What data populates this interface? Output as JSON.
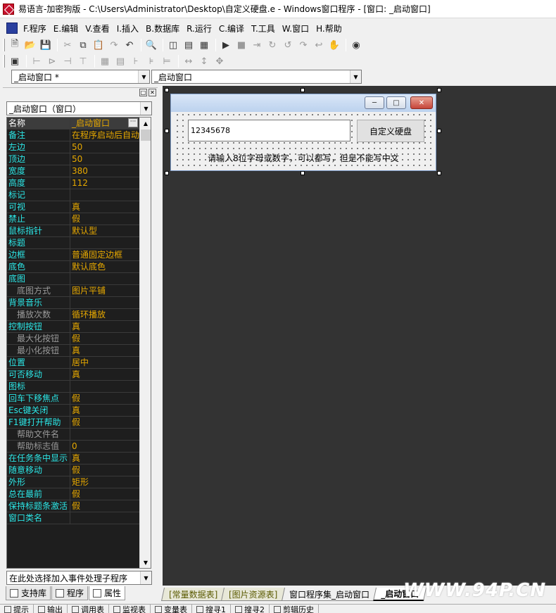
{
  "window": {
    "title": "易语言-加密狗版 - C:\\Users\\Administrator\\Desktop\\自定义硬盘.e - Windows窗口程序 - [窗口: _启动窗口]"
  },
  "menu": [
    {
      "label": "F.程序"
    },
    {
      "label": "E.编辑"
    },
    {
      "label": "V.查看"
    },
    {
      "label": "I.插入"
    },
    {
      "label": "B.数据库"
    },
    {
      "label": "R.运行"
    },
    {
      "label": "C.编译"
    },
    {
      "label": "T.工具"
    },
    {
      "label": "W.窗口"
    },
    {
      "label": "H.帮助"
    }
  ],
  "toolbar": {
    "icons": [
      "new-file-icon",
      "open-folder-icon",
      "save-icon",
      "cut-icon",
      "copy-icon",
      "paste-icon",
      "redo-icon",
      "undo-icon",
      "find-icon",
      "layout1-icon",
      "layout2-icon",
      "layout3-icon",
      "run-icon",
      "stop-icon",
      "step1-icon",
      "step2-icon",
      "step3-icon",
      "step4-icon",
      "step5-icon",
      "hand-icon",
      "binoculars-icon"
    ]
  },
  "selectors": {
    "left": "_启动窗口 *",
    "right": "_启动窗口"
  },
  "properties": {
    "object_combo": "_启动窗口（窗口）",
    "event_combo": "在此处选择加入事件处理子程序",
    "rows": [
      {
        "name": "名称",
        "value": "_启动窗口",
        "selected": true
      },
      {
        "name": "备注",
        "value": "在程序启动后自动"
      },
      {
        "name": "左边",
        "value": "50"
      },
      {
        "name": "顶边",
        "value": "50"
      },
      {
        "name": "宽度",
        "value": "380"
      },
      {
        "name": "高度",
        "value": "112"
      },
      {
        "name": "标记",
        "value": ""
      },
      {
        "name": "可视",
        "value": "真"
      },
      {
        "name": "禁止",
        "value": "假"
      },
      {
        "name": "鼠标指针",
        "value": "默认型"
      },
      {
        "name": "标题",
        "value": ""
      },
      {
        "name": "边框",
        "value": "普通固定边框"
      },
      {
        "name": "底色",
        "value": "默认底色"
      },
      {
        "name": "底图",
        "value": ""
      },
      {
        "name": "底图方式",
        "value": "图片平铺",
        "indent": true
      },
      {
        "name": "背景音乐",
        "value": ""
      },
      {
        "name": "播放次数",
        "value": "循环播放",
        "indent": true
      },
      {
        "name": "控制按钮",
        "value": "真"
      },
      {
        "name": "最大化按钮",
        "value": "假",
        "indent": true
      },
      {
        "name": "最小化按钮",
        "value": "真",
        "indent": true
      },
      {
        "name": "位置",
        "value": "居中"
      },
      {
        "name": "可否移动",
        "value": "真"
      },
      {
        "name": "图标",
        "value": ""
      },
      {
        "name": "回车下移焦点",
        "value": "假"
      },
      {
        "name": "Esc键关闭",
        "value": "真"
      },
      {
        "name": "F1键打开帮助",
        "value": "假"
      },
      {
        "name": "帮助文件名",
        "value": "",
        "indent": true
      },
      {
        "name": "帮助标志值",
        "value": "0",
        "indent": true
      },
      {
        "name": "在任务条中显示",
        "value": "真"
      },
      {
        "name": "随意移动",
        "value": "假"
      },
      {
        "name": "外形",
        "value": "矩形"
      },
      {
        "name": "总在最前",
        "value": "假"
      },
      {
        "name": "保持标题条激活",
        "value": "假"
      },
      {
        "name": "窗口类名",
        "value": ""
      }
    ]
  },
  "panel_tabs": [
    {
      "label": "支持库"
    },
    {
      "label": "程序"
    },
    {
      "label": "属性",
      "active": true
    }
  ],
  "design_form": {
    "input_value": "12345678",
    "button_label": "自定义硬盘",
    "hint": "请输入8位字母或数字，可以都写，但是不能写中文"
  },
  "doc_tabs": [
    {
      "label": "[常量数据表]",
      "kind": "data"
    },
    {
      "label": "[图片资源表]",
      "kind": "data"
    },
    {
      "label": "窗口程序集_启动窗口",
      "kind": "code"
    },
    {
      "label": "_启动窗口",
      "kind": "active"
    }
  ],
  "watermark": "WWW.94P.CN",
  "status_items": [
    {
      "label": "提示"
    },
    {
      "label": "输出"
    },
    {
      "label": "调用表"
    },
    {
      "label": "监视表"
    },
    {
      "label": "变量表"
    },
    {
      "label": "搜寻1"
    },
    {
      "label": "搜寻2"
    },
    {
      "label": "剪辑历史"
    }
  ]
}
